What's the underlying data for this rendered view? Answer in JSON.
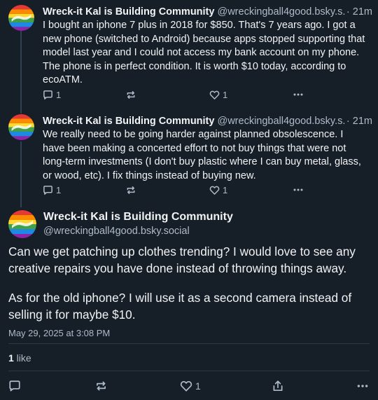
{
  "posts": [
    {
      "author": "Wreck-it Kal is Building Community",
      "handle": "@wreckingball4good.bsky.s...",
      "time": "21m",
      "text": "I bought an iphone 7 plus in 2018 for $850. That's 7 years ago. I got a new phone (switched to Android) because apps stopped supporting that model last year and I could not access my bank account on my phone. The phone is in perfect condition. It is worth $10 today, according to ecoATM.",
      "replies": "1",
      "likes": "1"
    },
    {
      "author": "Wreck-it Kal is Building Community",
      "handle": "@wreckingball4good.bsky.s...",
      "time": "21m",
      "text": "We really need to be going harder against planned obsolescence. I have been making a concerted effort to not buy things that were not long-term investments (I don't buy plastic where I can buy metal, glass, or wood, etc). I fix things instead of buying new.",
      "replies": "1",
      "likes": "1"
    }
  ],
  "main": {
    "author": "Wreck-it Kal is Building Community",
    "handle": "@wreckingball4good.bsky.social",
    "paragraph1": "Can we get patching up clothes trending? I would love to see any creative repairs you have done instead of throwing things away.",
    "paragraph2": "As for the old iphone? I will use it as a second camera instead of selling it for maybe $10.",
    "date": "May 29, 2025 at 3:08 PM",
    "like_count": "1",
    "like_word": " like",
    "likes": "1"
  },
  "icons": {
    "reply": "speech-bubble-icon",
    "repost": "repost-arrows-icon",
    "like": "heart-icon",
    "more": "ellipsis-icon",
    "share": "share-icon",
    "avatar": "rainbow-flag-avatar"
  },
  "colors": {
    "background": "#161e27",
    "text": "#f1f3f5",
    "muted": "#aebbc9"
  }
}
